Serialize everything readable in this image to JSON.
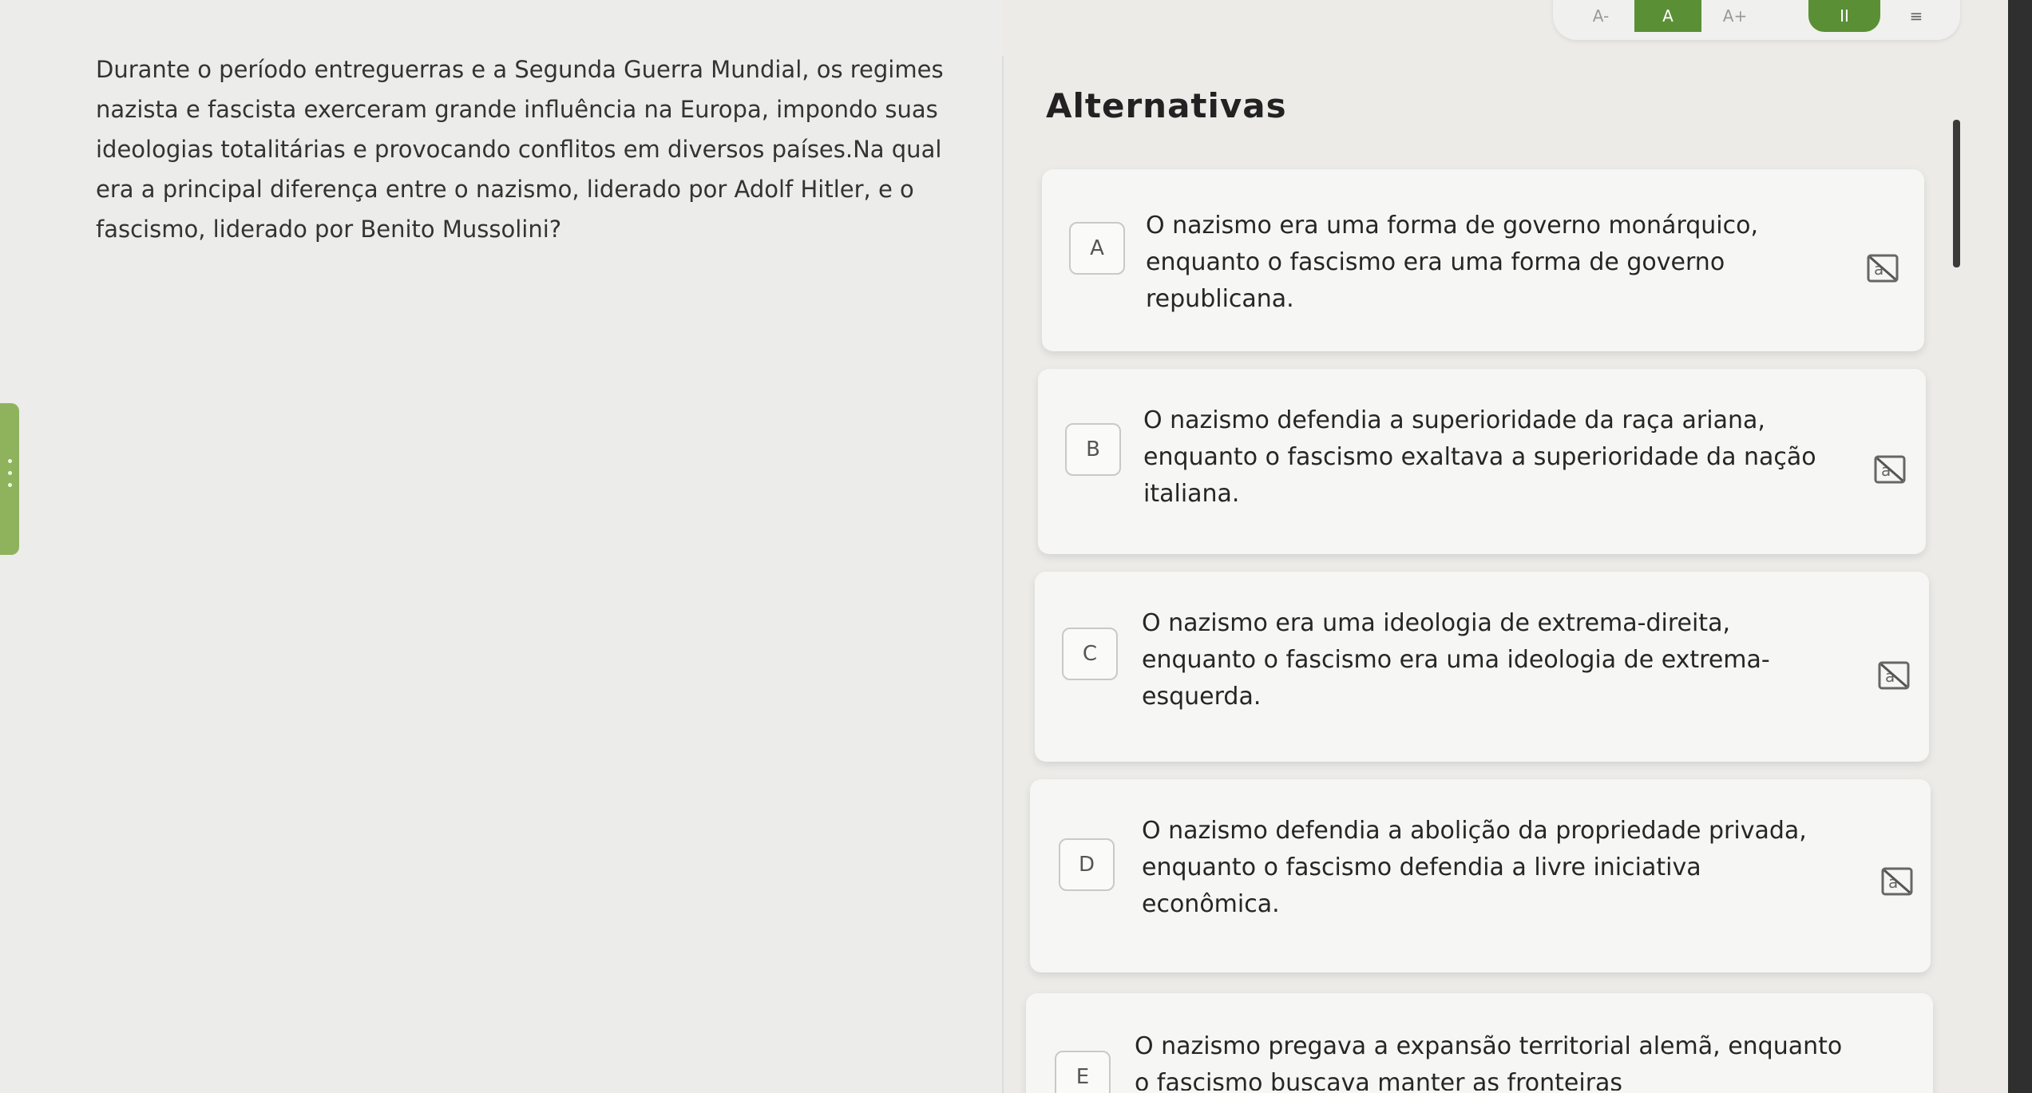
{
  "toolbar": {
    "font_decrease": "A-",
    "font_normal": "A",
    "font_increase": "A+",
    "pause_label": "II",
    "menu_label": "≡",
    "accent_color": "#5b8f35"
  },
  "question": {
    "text": "Durante o período entreguerras e a Segunda Guerra Mundial, os regimes nazista e fascista exerceram grande influência na Europa, impondo suas ideologias totalitárias e provocando conflitos em diversos países.Na qual era a principal diferença entre o nazismo, liderado por Adolf Hitler, e o fascismo, liderado por Benito Mussolini?"
  },
  "alternatives": {
    "title": "Alternativas",
    "items": [
      {
        "letter": "A",
        "text": "O nazismo era uma forma de governo monárquico, enquanto o fascismo era uma forma de governo republicana.",
        "icon": "strikethrough-icon"
      },
      {
        "letter": "B",
        "text": "O nazismo defendia a superioridade da raça ariana, enquanto o fascismo exaltava a superioridade da nação italiana.",
        "icon": "strikethrough-icon"
      },
      {
        "letter": "C",
        "text": "O nazismo era uma ideologia de extrema-direita, enquanto o fascismo era uma ideologia de extrema-esquerda.",
        "icon": "strikethrough-icon"
      },
      {
        "letter": "D",
        "text": "O nazismo defendia a abolição da propriedade privada, enquanto o fascismo defendia a livre iniciativa econômica.",
        "icon": "strikethrough-icon"
      },
      {
        "letter": "E",
        "text": "O nazismo pregava a expansão territorial alemã, enquanto o fascismo buscava manter as fronteiras",
        "icon": "strikethrough-icon"
      }
    ]
  }
}
